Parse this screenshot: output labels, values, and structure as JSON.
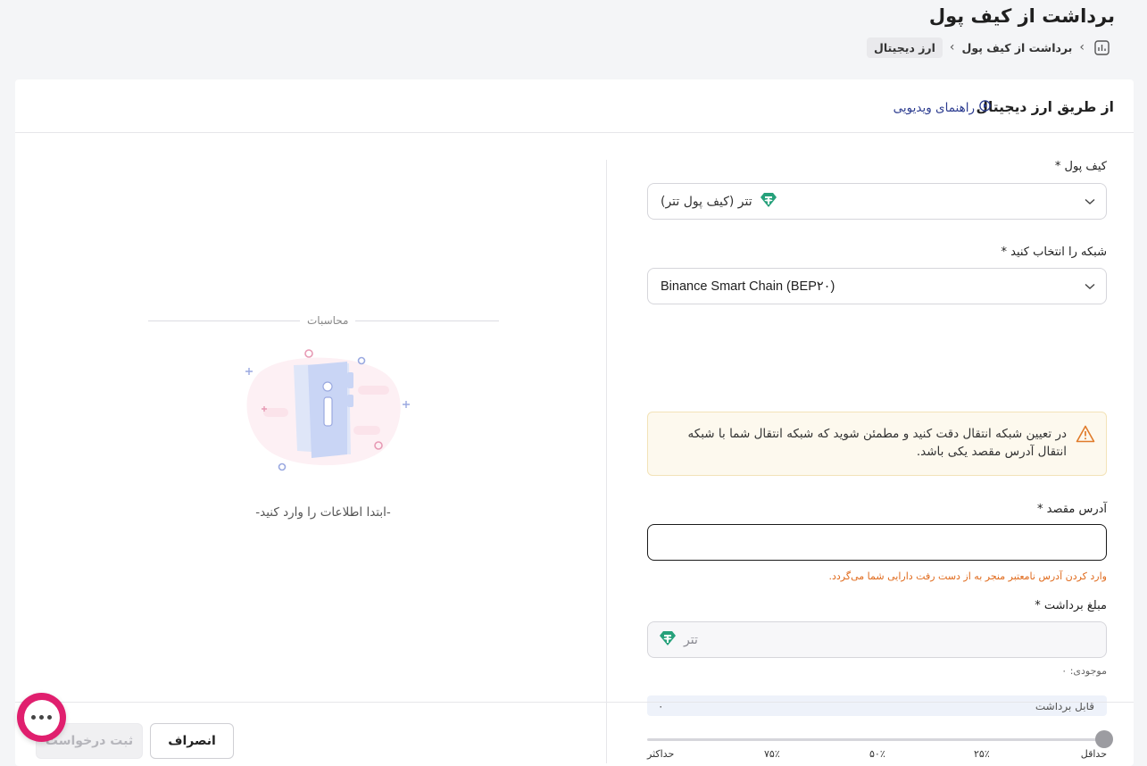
{
  "header": {
    "title": "برداشت از کیف پول",
    "breadcrumb": {
      "home_icon": "chart-icon",
      "items": [
        "برداشت از کیف پول",
        "ارز دیجیتال"
      ]
    }
  },
  "card": {
    "title": "از طریق ارز دیجیتال",
    "video_guide_label": "راهنمای ویدیویی",
    "video_icon": "play-circle-icon"
  },
  "form": {
    "wallet": {
      "label": "کیف پول *",
      "value": "تتر (کیف پول تتر)",
      "icon": "tether-icon"
    },
    "network": {
      "label": "شبکه را انتخاب کنید *",
      "value": "Binance Smart Chain (BEP۲۰)"
    },
    "warning": {
      "icon": "warning-triangle-icon",
      "text": "در تعیین شبکه انتقال دقت کنید و مطمئن شوید که شبکه انتقال شما با شبکه انتقال آدرس مقصد یکی باشد."
    },
    "address": {
      "label": "آدرس مقصد *",
      "value": "",
      "error_note": "وارد کردن آدرس نامعتبر منجر به از دست رفت دارایی شما می‌گردد."
    },
    "amount": {
      "label": "مبلغ برداشت *",
      "placeholder": "تتر",
      "balance": "موجودی: ۰"
    },
    "withdrawable": {
      "label": "قابل برداشت",
      "value": "۰"
    },
    "slider": {
      "value_percent": 0,
      "labels": [
        "حداقل",
        "۲۵٪",
        "۵۰٪",
        "۷۵٪",
        "حداکثر"
      ]
    }
  },
  "calculations": {
    "title": "محاسبات",
    "empty_text": "-ابتدا اطلاعات را وارد کنید-"
  },
  "footer": {
    "cancel_label": "انصراف",
    "submit_label": "ثبت درخواست"
  },
  "colors": {
    "accent": "#2b3b8f",
    "warning_bg": "#fdf9ee",
    "warning_icon": "#e07b2a",
    "error_text": "#e06a1c",
    "tether": "#26a17b",
    "chat_bubble": "#e01f6e"
  }
}
